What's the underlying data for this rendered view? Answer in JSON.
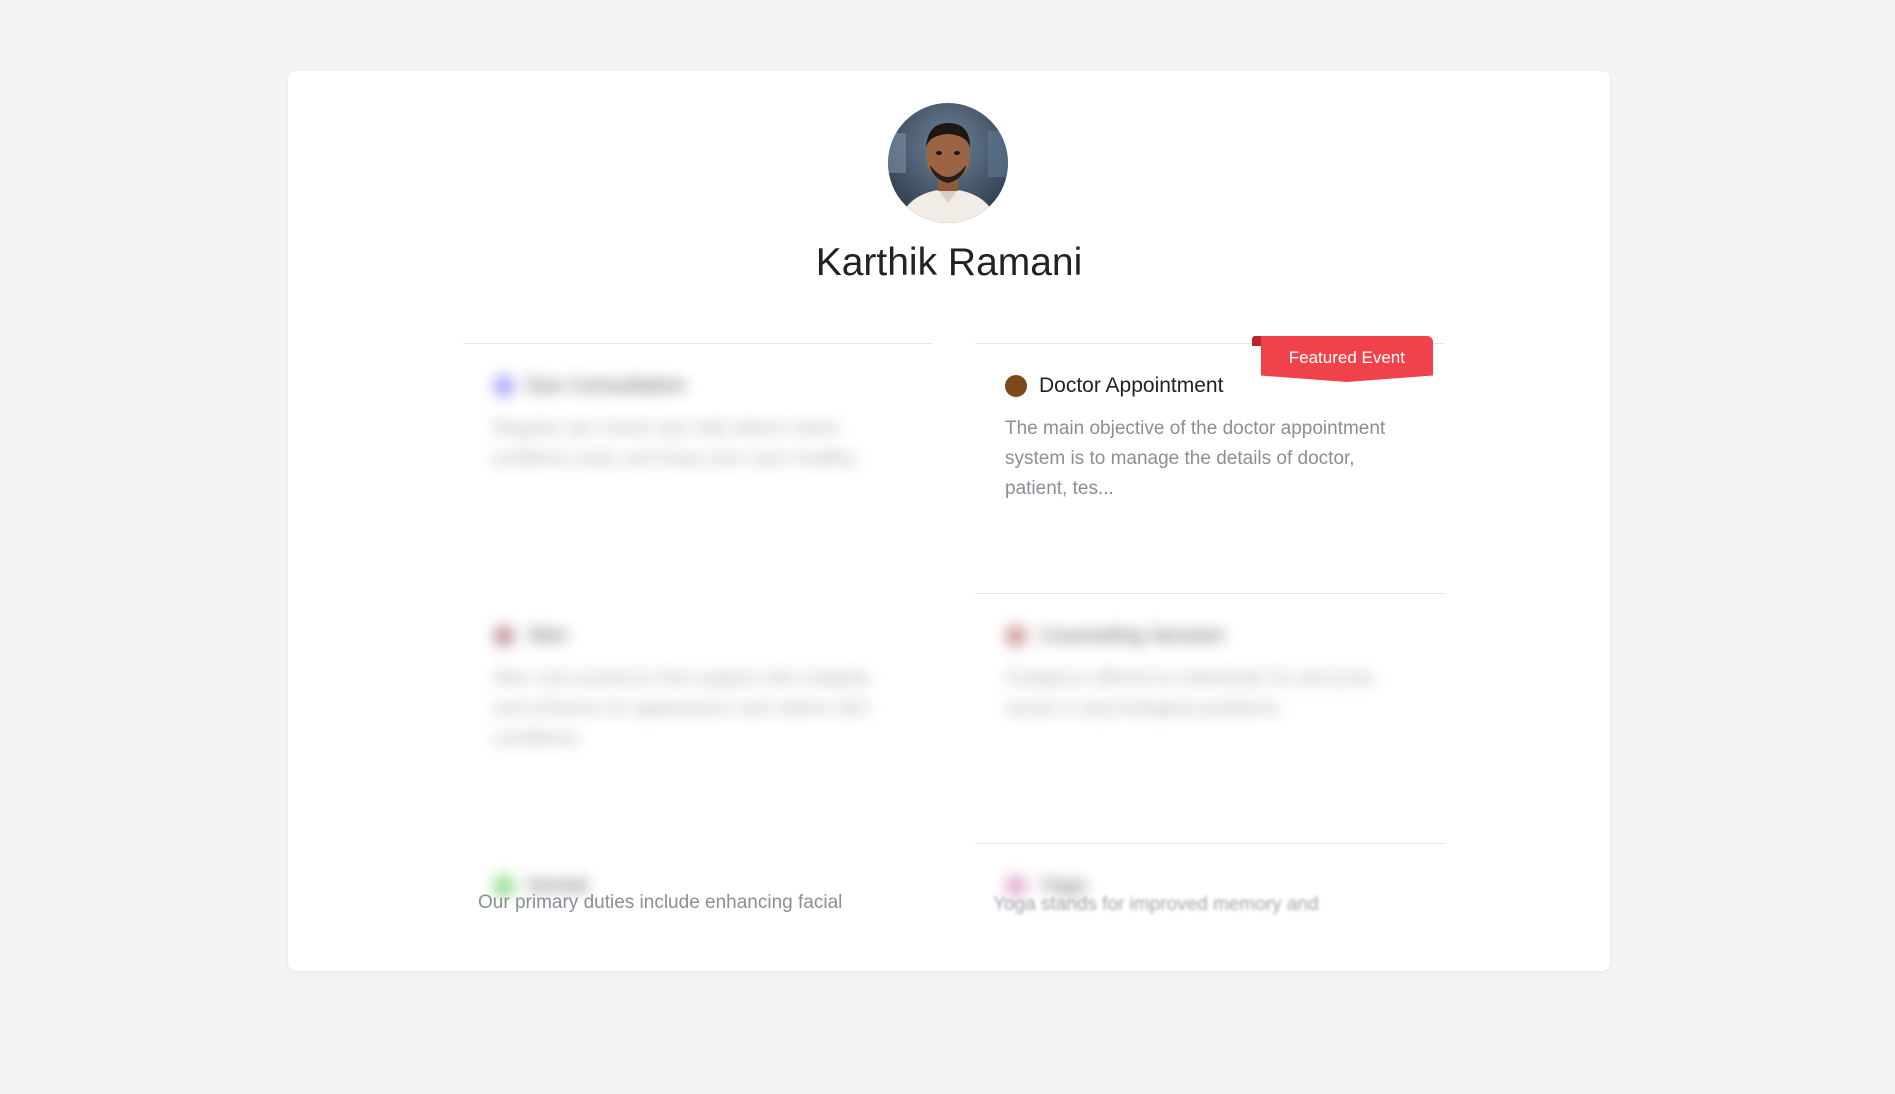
{
  "profile": {
    "name": "Karthik Ramani"
  },
  "events": [
    {
      "title": "Eye Consultation",
      "description": "Regular eye check-ups help detect vision problems early and keep your eyes healthy.",
      "dot_color": "#8f8cf0",
      "blurred": true
    },
    {
      "title": "Doctor Appointment",
      "description": "The main objective of the doctor appointment system is to manage the details of doctor, patient, tes...",
      "dot_color": "#7a4a1a",
      "blurred": false,
      "badge": "Featured Event"
    },
    {
      "title": "Skin",
      "description": "Skin care practices that support skin integrity and enhance its appearance and relieve skin conditions.",
      "dot_color": "#b07a86",
      "blurred": true
    },
    {
      "title": "Counseling Session",
      "description": "Guidance offered to individuals for personal, social or psychological problems.",
      "dot_color": "#c27a7a",
      "blurred": true
    },
    {
      "title": "Dental",
      "description": "Our primary duties include enhancing facial",
      "dot_color": "#6fd36b",
      "blurred": true
    },
    {
      "title": "Yoga",
      "description": "Yoga stands for improved memory and",
      "dot_color": "#d98fc0",
      "blurred": true
    }
  ]
}
